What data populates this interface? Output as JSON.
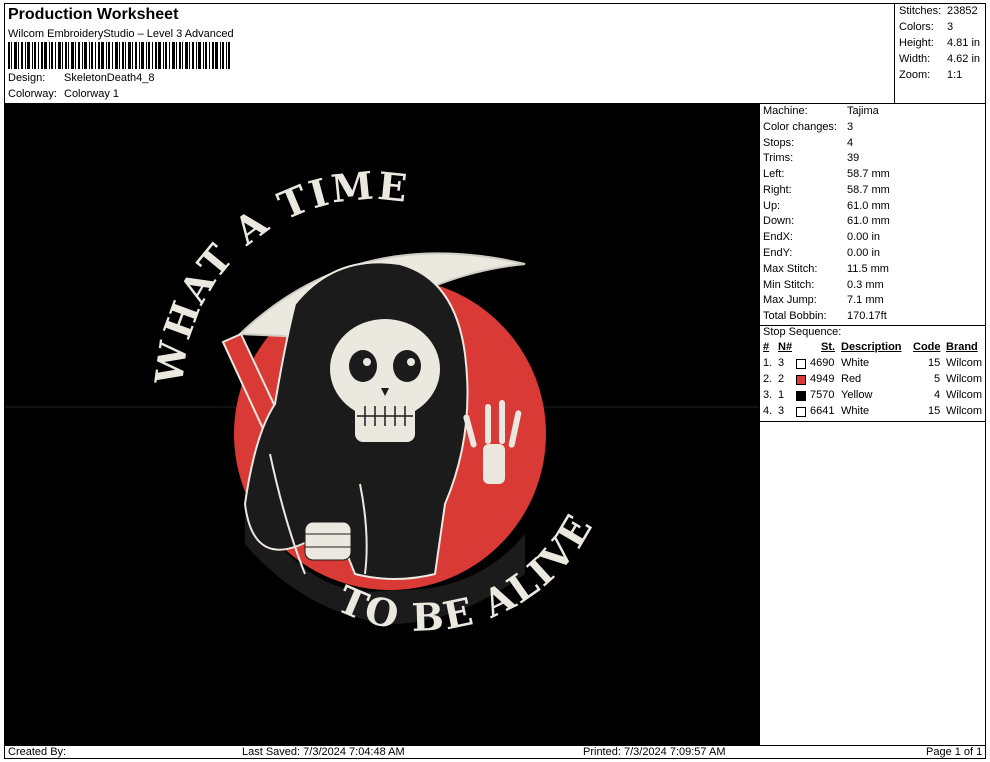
{
  "header": {
    "title": "Production Worksheet",
    "subtitle": "Wilcom EmbroideryStudio – Level 3 Advanced",
    "design_label": "Design:",
    "design_value": "SkeletonDeath4_8",
    "colorway_label": "Colorway:",
    "colorway_value": "Colorway 1"
  },
  "stats": [
    {
      "label": "Stitches:",
      "value": "23852"
    },
    {
      "label": "Colors:",
      "value": "3"
    },
    {
      "label": "Height:",
      "value": "4.81 in"
    },
    {
      "label": "Width:",
      "value": "4.62 in"
    },
    {
      "label": "Zoom:",
      "value": "1:1"
    }
  ],
  "machine_info": [
    {
      "label": "Machine:",
      "value": "Tajima"
    },
    {
      "label": "Color changes:",
      "value": "3"
    },
    {
      "label": "Stops:",
      "value": "4"
    },
    {
      "label": "Trims:",
      "value": "39"
    },
    {
      "label": "Left:",
      "value": "58.7 mm"
    },
    {
      "label": "Right:",
      "value": "58.7 mm"
    },
    {
      "label": "Up:",
      "value": "61.0 mm"
    },
    {
      "label": "Down:",
      "value": "61.0 mm"
    },
    {
      "label": "EndX:",
      "value": "0.00 in"
    },
    {
      "label": "EndY:",
      "value": "0.00 in"
    },
    {
      "label": "Max Stitch:",
      "value": "11.5 mm"
    },
    {
      "label": "Min Stitch:",
      "value": "0.3 mm"
    },
    {
      "label": "Max Jump:",
      "value": "7.1 mm"
    },
    {
      "label": "Total Bobbin:",
      "value": "170.17ft"
    }
  ],
  "stop_sequence": {
    "title": "Stop Sequence:",
    "headers": {
      "num": "#",
      "n": "N#",
      "st": "St.",
      "description": "Description",
      "code": "Code",
      "brand": "Brand"
    },
    "rows": [
      {
        "num": "1.",
        "n": "3",
        "color": "#ffffff",
        "st": "4690",
        "description": "White",
        "code": "15",
        "brand": "Wilcom"
      },
      {
        "num": "2.",
        "n": "2",
        "color": "#d93a35",
        "st": "4949",
        "description": "Red",
        "code": "5",
        "brand": "Wilcom"
      },
      {
        "num": "3.",
        "n": "1",
        "color": "#000000",
        "st": "7570",
        "description": "Yellow",
        "code": "4",
        "brand": "Wilcom"
      },
      {
        "num": "4.",
        "n": "3",
        "color": "#ffffff",
        "st": "6641",
        "description": "White",
        "code": "15",
        "brand": "Wilcom"
      }
    ]
  },
  "design": {
    "text_top": "WHAT A TIME",
    "text_bottom": "TO BE ALIVE",
    "colors": {
      "background": "#000000",
      "thread_white": "#ebe8e0",
      "thread_red": "#d93a35",
      "thread_dark": "#1b1b1b"
    }
  },
  "footer": {
    "created_by": "Created By:",
    "last_saved": "Last Saved: 7/3/2024 7:04:48 AM",
    "printed": "Printed: 7/3/2024 7:09:57 AM",
    "page": "Page 1 of 1"
  }
}
